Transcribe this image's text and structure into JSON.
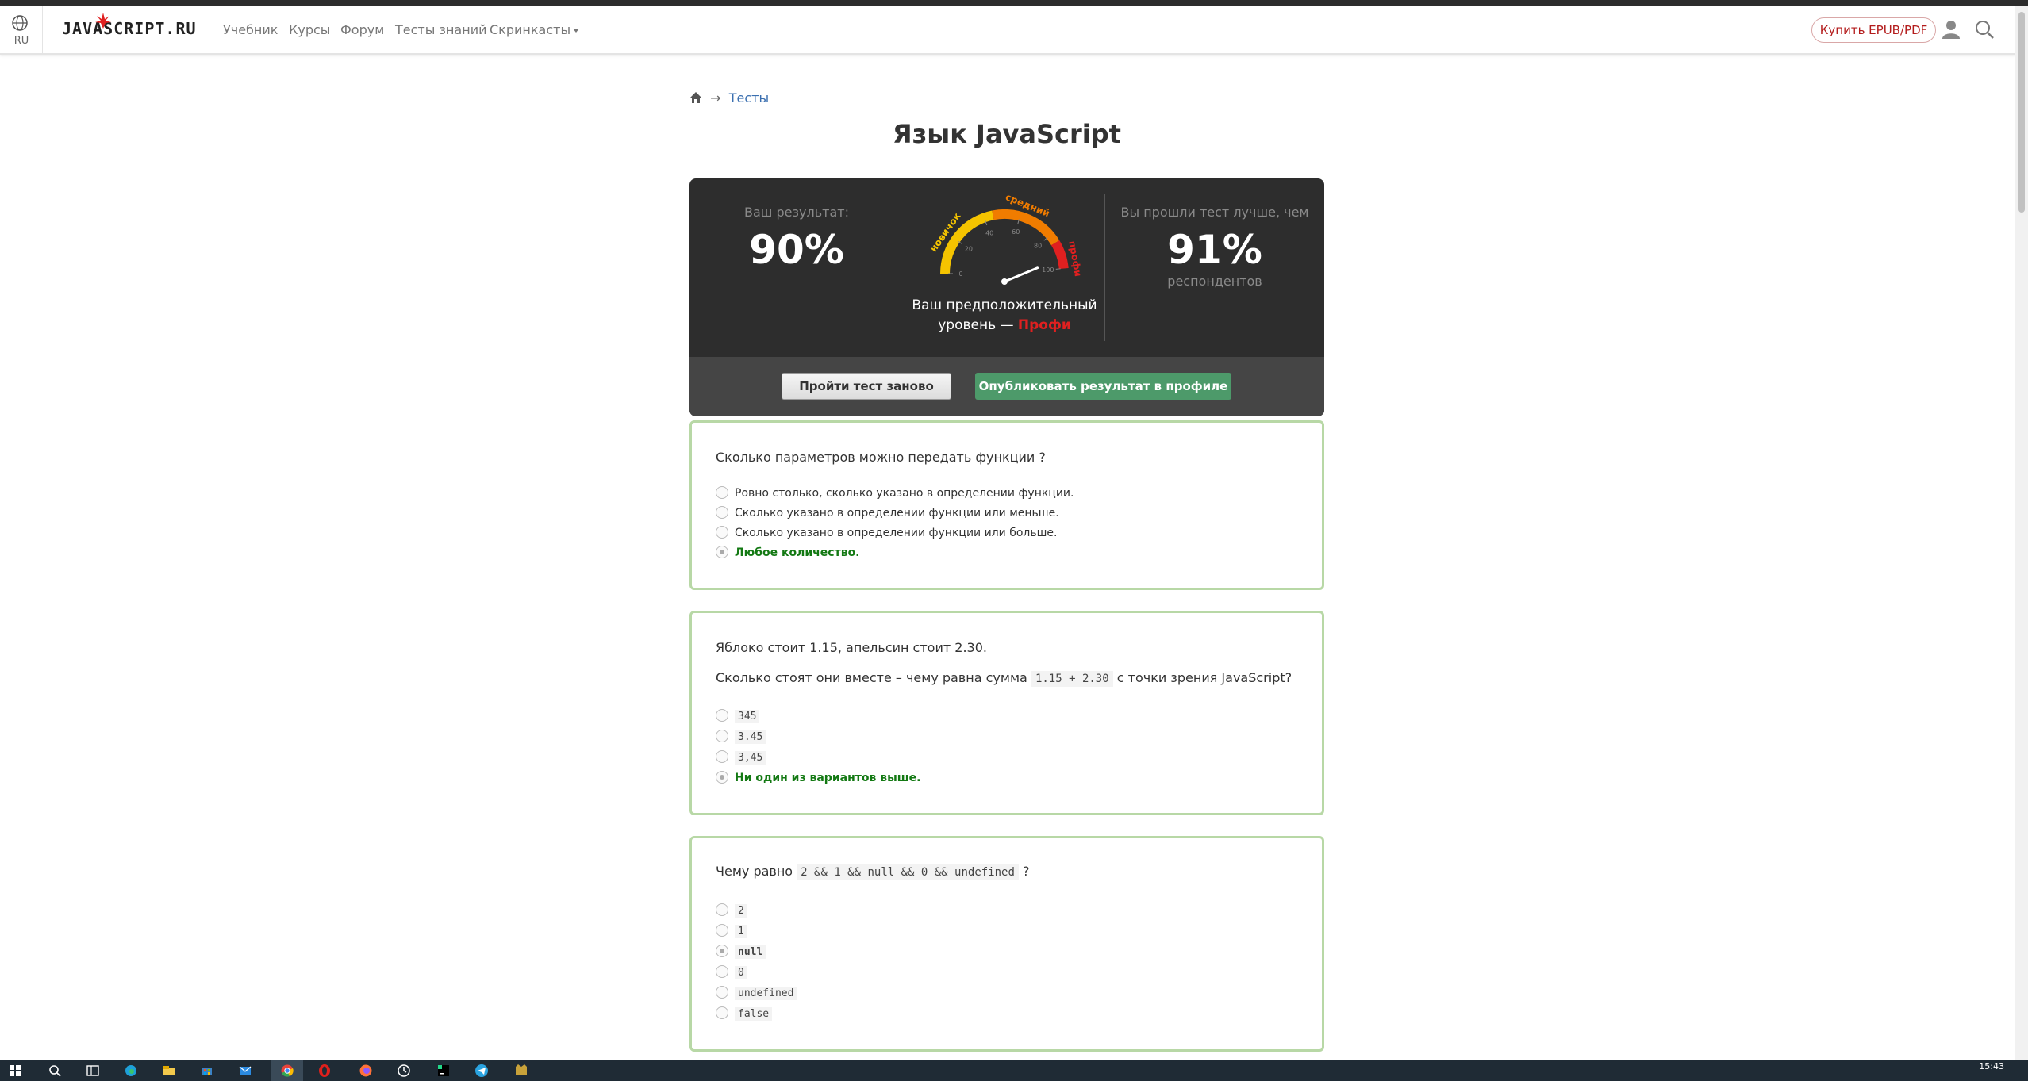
{
  "header": {
    "lang_code": "RU",
    "logo_text": "JAVASCRIPT.RU",
    "nav": [
      "Учебник",
      "Курсы",
      "Форум",
      "Тесты знаний",
      "Скринкасты"
    ],
    "buy_label": "Купить EPUB/PDF"
  },
  "breadcrumb": {
    "link": "Тесты"
  },
  "page_title": "Язык JavaScript",
  "result": {
    "score_label": "Ваш результат:",
    "score": "90%",
    "compare_label": "Вы прошли тест лучше, чем",
    "percentile": "91%",
    "percentile_sub": "респондентов",
    "gauge": {
      "level_fraction": 0.9,
      "labels": [
        "новичок",
        "средний",
        "профи"
      ],
      "ticks": [
        "0",
        "20",
        "40",
        "60",
        "80",
        "100"
      ],
      "colors": {
        "low": "#f5c400",
        "mid": "#f07c00",
        "high": "#e02020"
      }
    },
    "level_text": "Ваш предположительный уровень —",
    "level_value": "Профи",
    "retry_label": "Пройти тест заново",
    "publish_label": "Опубликовать результат в профиле"
  },
  "questions": [
    {
      "text": "Сколько параметров можно передать функции ?",
      "options": [
        "Ровно столько, сколько указано в определении функции.",
        "Сколько указано в определении функции или меньше.",
        "Сколько указано в определении функции или больше.",
        "Любое количество."
      ],
      "correct_index": 3
    },
    {
      "text": "Яблоко стоит 1.15, апельсин стоит 2.30.",
      "text2_before": "Сколько стоят они вместе – чему равна сумма",
      "text2_code": "1.15 + 2.30",
      "text2_after": "с точки зрения JavaScript?",
      "options": [
        "345",
        "3.45",
        "3,45",
        "Ни один из вариантов выше."
      ],
      "correct_index": 3
    },
    {
      "text_before": "Чему равно",
      "text_code": "2 && 1 && null && 0 && undefined",
      "text_after": "?",
      "options": [
        "2",
        "1",
        "null",
        "0",
        "undefined",
        "false"
      ],
      "selected_index": 2
    }
  ],
  "taskbar": {
    "time": "15:43"
  },
  "colors": {
    "accent_link": "#3a6fb0",
    "correct": "#137913",
    "publish_btn": "#4d9a6a",
    "card_border": "#b8d8a6"
  }
}
